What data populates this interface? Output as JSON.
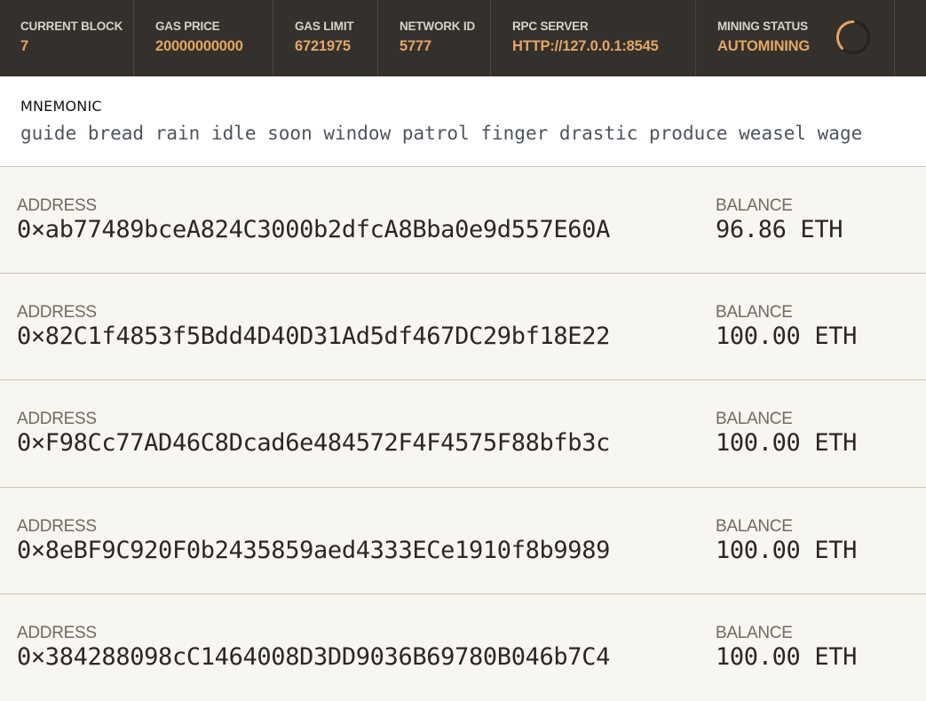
{
  "status": {
    "current_block": {
      "label": "CURRENT BLOCK",
      "value": "7"
    },
    "gas_price": {
      "label": "GAS PRICE",
      "value": "20000000000"
    },
    "gas_limit": {
      "label": "GAS LIMIT",
      "value": "6721975"
    },
    "network_id": {
      "label": "NETWORK ID",
      "value": "5777"
    },
    "rpc_server": {
      "label": "RPC SERVER",
      "value": "HTTP://127.0.0.1:8545"
    },
    "mining_status": {
      "label": "MINING STATUS",
      "value": "AUTOMINING",
      "spinner_icon": "loading-spinner-icon"
    }
  },
  "colors": {
    "status_bar_bg": "#34312d",
    "status_value": "#e4a663",
    "page_bg": "#f8f6f1"
  },
  "mnemonic": {
    "label": "MNEMONIC",
    "phrase": "guide bread rain idle soon window patrol finger drastic produce weasel wage"
  },
  "accounts": [
    {
      "address_label": "ADDRESS",
      "address": "0×ab77489bceA824C3000b2dfcA8Bba0e9d557E60A",
      "balance_label": "BALANCE",
      "balance": "96.86 ETH"
    },
    {
      "address_label": "ADDRESS",
      "address": "0×82C1f4853f5Bdd4D40D31Ad5df467DC29bf18E22",
      "balance_label": "BALANCE",
      "balance": "100.00 ETH"
    },
    {
      "address_label": "ADDRESS",
      "address": "0×F98Cc77AD46C8Dcad6e484572F4F4575F88bfb3c",
      "balance_label": "BALANCE",
      "balance": "100.00 ETH"
    },
    {
      "address_label": "ADDRESS",
      "address": "0×8eBF9C920F0b2435859aed4333ECe1910f8b9989",
      "balance_label": "BALANCE",
      "balance": "100.00 ETH"
    },
    {
      "address_label": "ADDRESS",
      "address": "0×384288098cC1464008D3DD9036B69780B046b7C4",
      "balance_label": "BALANCE",
      "balance": "100.00 ETH"
    }
  ]
}
